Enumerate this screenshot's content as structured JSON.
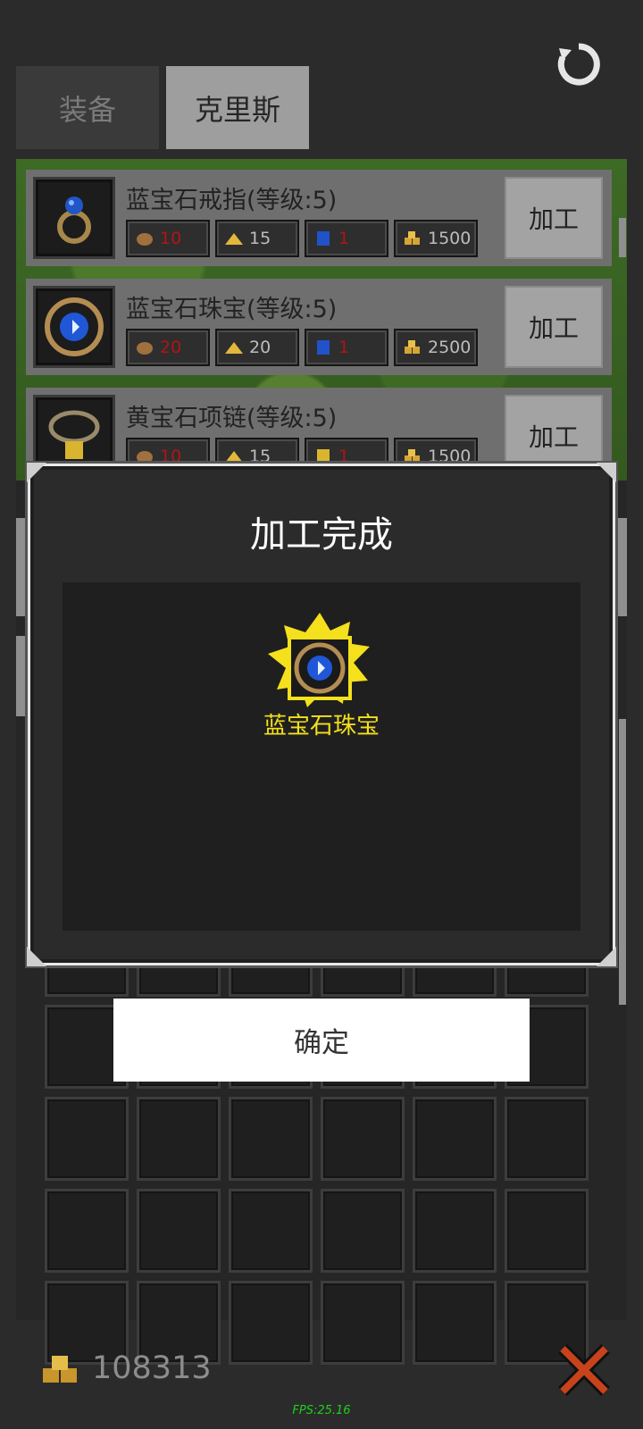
{
  "tabs": [
    {
      "label": "装备"
    },
    {
      "label": "克里斯"
    }
  ],
  "recipes": [
    {
      "name": "蓝宝石戒指(等级:5)",
      "costs": [
        "10",
        "15",
        "1",
        "1500"
      ],
      "button": "加工"
    },
    {
      "name": "蓝宝石珠宝(等级:5)",
      "costs": [
        "20",
        "20",
        "1",
        "2500"
      ],
      "button": "加工"
    },
    {
      "name": "黄宝石项链(等级:5)",
      "costs": [
        "10",
        "15",
        "1",
        "1500"
      ],
      "button": "加工"
    }
  ],
  "dialog": {
    "title": "加工完成",
    "result_item": "蓝宝石珠宝",
    "confirm_label": "确定"
  },
  "footer": {
    "gold": "108313",
    "fps": "FPS:25.16"
  },
  "colors": {
    "insufficient": "#b01515",
    "result_highlight": "#f4e01c",
    "fps_text": "#1fcf1f"
  }
}
